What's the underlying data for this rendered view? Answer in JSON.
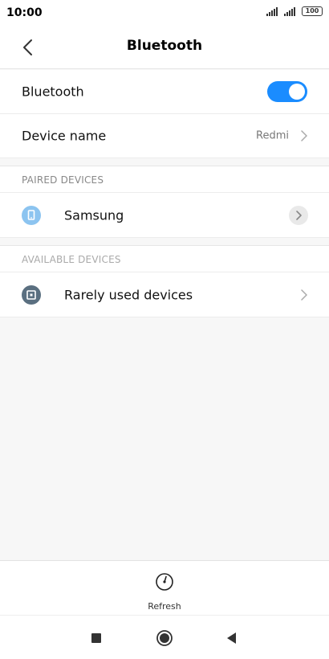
{
  "status_bar": {
    "time": "10:00",
    "battery": "100"
  },
  "header": {
    "title": "Bluetooth"
  },
  "settings": {
    "bluetooth_label": "Bluetooth",
    "bluetooth_on": true,
    "device_name_label": "Device name",
    "device_name_value": "Redmi"
  },
  "paired": {
    "header": "PAIRED DEVICES",
    "devices": [
      {
        "name": "Samsung",
        "icon": "phone-icon"
      }
    ]
  },
  "available": {
    "header": "AVAILABLE DEVICES",
    "items": [
      {
        "name": "Rarely used devices",
        "icon": "device-square-icon"
      }
    ]
  },
  "bottom": {
    "refresh_label": "Refresh"
  },
  "colors": {
    "accent": "#1a8cff",
    "paired_icon": "#8cc4f0",
    "available_icon": "#5a6f80"
  }
}
